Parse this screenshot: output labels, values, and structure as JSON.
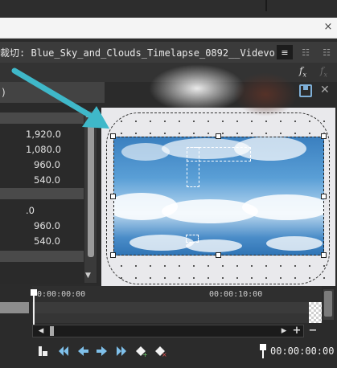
{
  "window": {
    "title": "裁切: Blue_Sky_and_Clouds_Timelapse_0892__Videvo",
    "close_glyph": "×"
  },
  "toolbar": {
    "fx_label": "f",
    "fx_sub": "x",
    "header_label": ")"
  },
  "properties": {
    "group1": [
      "1,920.0",
      "1,080.0",
      "960.0",
      "540.0"
    ],
    "group2": [
      ".0",
      "960.0",
      "540.0"
    ]
  },
  "timeline": {
    "start_tc": "0:00:00:00",
    "mark_tc": "00:00:10:00",
    "current_time": "00:00:00:00"
  },
  "colors": {
    "accent_arrow": "#3fb8c9",
    "sky_top": "#3a7fbf"
  }
}
